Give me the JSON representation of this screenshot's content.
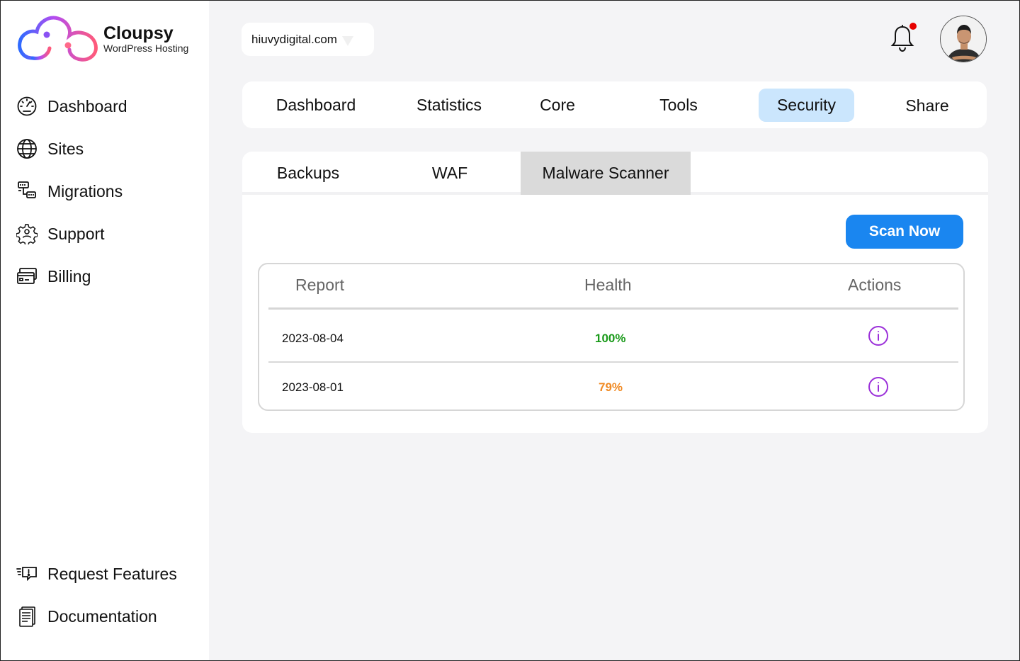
{
  "brand": {
    "name": "Cloupsy",
    "tagline": "WordPress Hosting"
  },
  "sidebar": {
    "items": [
      {
        "label": "Dashboard",
        "icon": "gauge-icon"
      },
      {
        "label": "Sites",
        "icon": "globe-icon"
      },
      {
        "label": "Migrations",
        "icon": "migration-icon"
      },
      {
        "label": "Support",
        "icon": "support-gear-icon"
      },
      {
        "label": "Billing",
        "icon": "credit-card-icon"
      }
    ],
    "bottom_items": [
      {
        "label": "Request Features",
        "icon": "feature-request-icon"
      },
      {
        "label": "Documentation",
        "icon": "document-icon"
      }
    ]
  },
  "topbar": {
    "domain": "hiuvydigital.com",
    "has_notification": true
  },
  "main_tabs": [
    "Dashboard",
    "Statistics",
    "Core",
    "Tools",
    "Security",
    "Share"
  ],
  "active_main_tab": "Security",
  "sub_tabs": [
    "Backups",
    "WAF",
    "Malware Scanner"
  ],
  "active_sub_tab": "Malware Scanner",
  "scan_button": "Scan Now",
  "table": {
    "columns": [
      "Report",
      "Health",
      "Actions"
    ],
    "rows": [
      {
        "date": "2023-08-04",
        "health": "100%",
        "health_color": "#1a9a1a"
      },
      {
        "date": "2023-08-01",
        "health": "79%",
        "health_color": "#f08a24"
      }
    ]
  },
  "colors": {
    "accent": "#1a86f0",
    "active_tab": "#cbe6fd",
    "info_icon": "#9b30d9",
    "notification_dot": "#e60000"
  }
}
